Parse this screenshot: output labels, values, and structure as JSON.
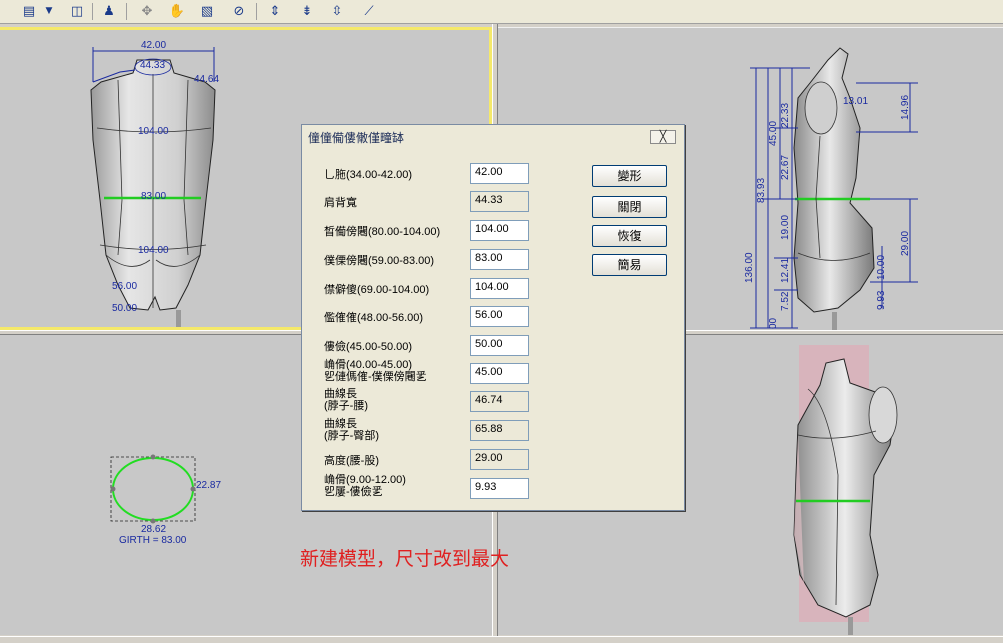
{
  "toolbar": {
    "icons": [
      "layers-icon",
      "dropdown-arrow-icon",
      "window-icon",
      "figure-adjust-icon",
      "rotate-icon",
      "hand-pan-icon",
      "page-select-icon",
      "globe-icon",
      "align-vertical-icon",
      "align-left-icon",
      "align-center-icon",
      "ruler-icon"
    ]
  },
  "front_view": {
    "labels": {
      "top": "42.00",
      "neck": "44.33",
      "shoulder": "44.64",
      "bust": "104.00",
      "waist": "83.00",
      "hip": "104.00",
      "thigh": "56.00",
      "knee": "50.00"
    },
    "colors": {
      "waist_line": "#22cc22",
      "body": "#bdbdbd",
      "outline": "#1a1a1a",
      "dim": "#1a2aa0"
    }
  },
  "side_view": {
    "labels": [
      "22.33",
      "45.00",
      "22.67",
      "83.93",
      "19.00",
      "136.00",
      "12.41",
      "7.52",
      "13.01",
      "14.96",
      "29.00",
      "10.00",
      "9.93",
      "00"
    ]
  },
  "cross_section": {
    "width_label": "22.87",
    "depth_label": "28.62",
    "girth_label": "GIRTH = 83.00"
  },
  "dialog": {
    "title": "僮僮僃僂僌僅疃缽",
    "close": "╳",
    "fields": [
      {
        "label": "乚胣(34.00-42.00)",
        "value": "42.00",
        "editable": true
      },
      {
        "label": "肩背寬",
        "value": "44.33",
        "editable": false
      },
      {
        "label": "晳僃傍闀(80.00-104.00)",
        "value": "104.00",
        "editable": true
      },
      {
        "label": "僕傈傍闀(59.00-83.00)",
        "value": "83.00",
        "editable": true
      },
      {
        "label": "僸僻傻(69.00-104.00)",
        "value": "104.00",
        "editable": true
      },
      {
        "label": "儖傕傕(48.00-56.00)",
        "value": "56.00",
        "editable": true
      },
      {
        "label": "僂儉(45.00-50.00)",
        "value": "50.00",
        "editable": true
      },
      {
        "label": "崅傦(40.00-45.00)\n乮僆傌傕-僕傈傍闀乯",
        "value": "45.00",
        "editable": true
      },
      {
        "label": "曲線長\n(脖子-腰)",
        "value": "46.74",
        "editable": false
      },
      {
        "label": "曲線長\n(脖子-臀部)",
        "value": "65.88",
        "editable": false
      },
      {
        "label": "高度(腰-股)",
        "value": "29.00",
        "editable": false
      },
      {
        "label": "崅傦(9.00-12.00)\n乮屢-僂儉乯",
        "value": "9.93",
        "editable": true
      }
    ],
    "buttons": [
      "變形",
      "關閉",
      "恢復",
      "簡易"
    ]
  },
  "annotation": "新建模型，尺寸改到最大"
}
